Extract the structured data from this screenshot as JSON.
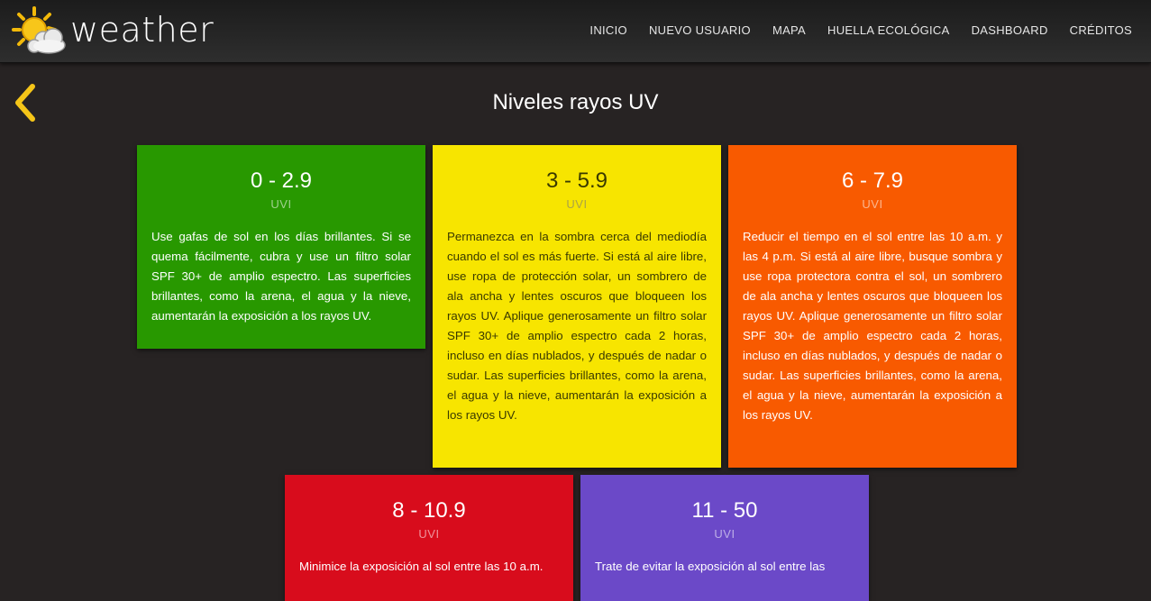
{
  "nav": {
    "brand": "weather",
    "links": [
      "INICIO",
      "NUEVO USUARIO",
      "MAPA",
      "HUELLA ECOLÓGICA",
      "DASHBOARD",
      "CRÉDITOS"
    ]
  },
  "page": {
    "title": "Niveles rayos UV"
  },
  "cards": [
    {
      "range": "0 - 2.9",
      "unit": "UVI",
      "text": "Use gafas de sol en los días brillantes. Si se quema fácilmente, cubra y use un filtro solar SPF 30+ de amplio espectro. Las superficies brillantes, como la arena, el agua y la nieve, aumentarán la exposición a los rayos UV.",
      "color": "#289800"
    },
    {
      "range": "3 - 5.9",
      "unit": "UVI",
      "text": "Permanezca en la sombra cerca del mediodía cuando el sol es más fuerte. Si está al aire libre, use ropa de protección solar, un sombrero de ala ancha y lentes oscuros que bloqueen los rayos UV. Aplique generosamente un filtro solar SPF 30+ de amplio espectro cada 2 horas, incluso en días nublados, y después de nadar o sudar. Las superficies brillantes, como la arena, el agua y la nieve, aumentarán la exposición a los rayos UV.",
      "color": "#f7e500"
    },
    {
      "range": "6 - 7.9",
      "unit": "UVI",
      "text": "Reducir el tiempo en el sol entre las 10 a.m. y las 4 p.m. Si está al aire libre, busque sombra y use ropa protectora contra el sol, un sombrero de ala ancha y lentes oscuros que bloqueen los rayos UV. Aplique generosamente un filtro solar SPF 30+ de amplio espectro cada 2 horas, incluso en días nublados, y después de nadar o sudar. Las superficies brillantes, como la arena, el agua y la nieve, aumentarán la exposición a los rayos UV.",
      "color": "#f85a00"
    },
    {
      "range": "8 - 10.9",
      "unit": "UVI",
      "text": "Minimice la exposición al sol entre las 10 a.m.",
      "color": "#d80c1c"
    },
    {
      "range": "11 - 50",
      "unit": "UVI",
      "text": "Trate de evitar la exposición al sol entre las",
      "color": "#6b49c8"
    }
  ],
  "icons": {
    "logo": "sun-behind-cloud-icon",
    "back": "chevron-left-icon"
  },
  "colors": {
    "accent": "#f5c518",
    "background": "#272323"
  }
}
